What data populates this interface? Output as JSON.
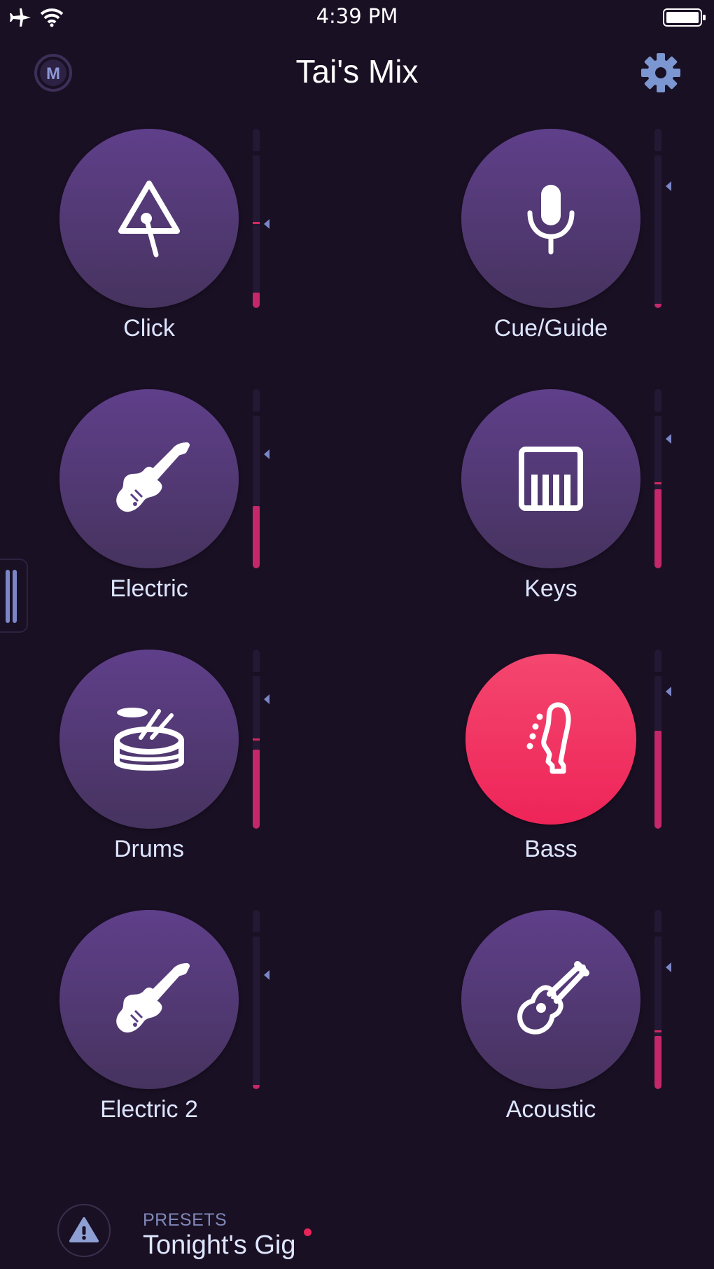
{
  "status": {
    "time": "4:39 PM",
    "left_icons": [
      "airplane-icon",
      "wifi-icon"
    ],
    "right_icons": [
      "battery-icon"
    ]
  },
  "header": {
    "title": "Tai's Mix",
    "left_icon": "m-logo-icon",
    "left_letter": "M",
    "right_icon": "gear-icon"
  },
  "channels": [
    {
      "label": "Click",
      "icon": "triangle-instrument-icon",
      "active": false,
      "level": 0.1,
      "peak": 0.55,
      "pointer": 0.45
    },
    {
      "label": "Cue/Guide",
      "icon": "microphone-icon",
      "active": false,
      "level": 0.02,
      "peak": null,
      "pointer": 0.2
    },
    {
      "label": "Electric",
      "icon": "electric-guitar-icon",
      "active": false,
      "level": 0.41,
      "peak": null,
      "pointer": 0.25
    },
    {
      "label": "Keys",
      "icon": "keyboard-icon",
      "active": false,
      "level": 0.52,
      "peak": 0.55,
      "pointer": 0.15
    },
    {
      "label": "Drums",
      "icon": "drum-icon",
      "active": false,
      "level": 0.52,
      "peak": 0.58,
      "pointer": 0.15
    },
    {
      "label": "Bass",
      "icon": "bass-headstock-icon",
      "active": true,
      "level": 0.64,
      "peak": null,
      "pointer": 0.1
    },
    {
      "label": "Electric 2",
      "icon": "electric-guitar-icon",
      "active": false,
      "level": 0.02,
      "peak": null,
      "pointer": 0.25
    },
    {
      "label": "Acoustic",
      "icon": "acoustic-guitar-icon",
      "active": false,
      "level": 0.35,
      "peak": 0.37,
      "pointer": 0.2
    }
  ],
  "presets": {
    "kicker": "PRESETS",
    "name": "Tonight's Gig",
    "warning_icon": "warning-icon",
    "indicator_color": "#e8245a"
  },
  "colors": {
    "background": "#1a1024",
    "channel_button": "#52397a",
    "active_button": "#f0305e",
    "meter_fill": "#c4286a",
    "accent_blue": "#7b86c6"
  }
}
